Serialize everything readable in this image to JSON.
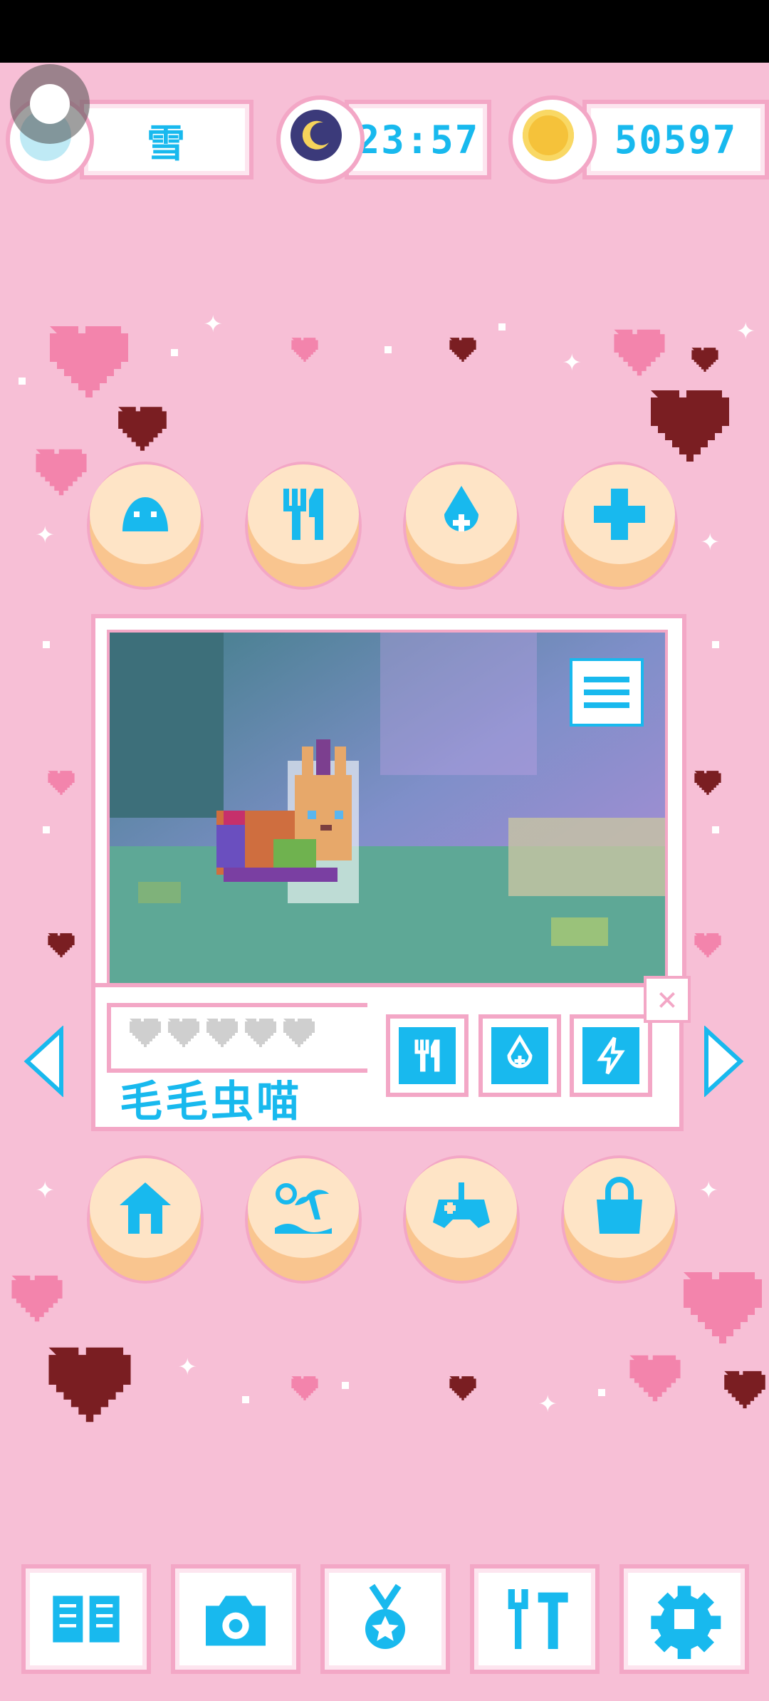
{
  "status": {
    "weather_label": "雪",
    "weather_icon": "snowflake-icon",
    "time": "23:57",
    "time_icon": "moon-night-icon",
    "coins": "50597",
    "coins_icon": "gold-coin-icon"
  },
  "care_buttons": [
    {
      "name": "slime-icon"
    },
    {
      "name": "fork-knife-icon"
    },
    {
      "name": "water-drop-icon"
    },
    {
      "name": "medical-cross-icon"
    }
  ],
  "pet": {
    "name": "毛毛虫喵",
    "hearts_total": 5,
    "hearts_filled": 0,
    "stat_buttons": [
      "food-stat-icon",
      "water-stat-icon",
      "energy-stat-icon"
    ]
  },
  "action_buttons": [
    {
      "name": "home-icon"
    },
    {
      "name": "beach-icon"
    },
    {
      "name": "gamepad-icon"
    },
    {
      "name": "shopping-bag-icon"
    }
  ],
  "toolbar": [
    {
      "name": "book-icon"
    },
    {
      "name": "camera-icon"
    },
    {
      "name": "medal-icon"
    },
    {
      "name": "tools-icon"
    },
    {
      "name": "settings-gear-icon"
    }
  ],
  "colors": {
    "background": "#f7bfd6",
    "accent": "#18b9ee",
    "frame": "#f3a7c6",
    "button_face": "#fee4c6"
  }
}
